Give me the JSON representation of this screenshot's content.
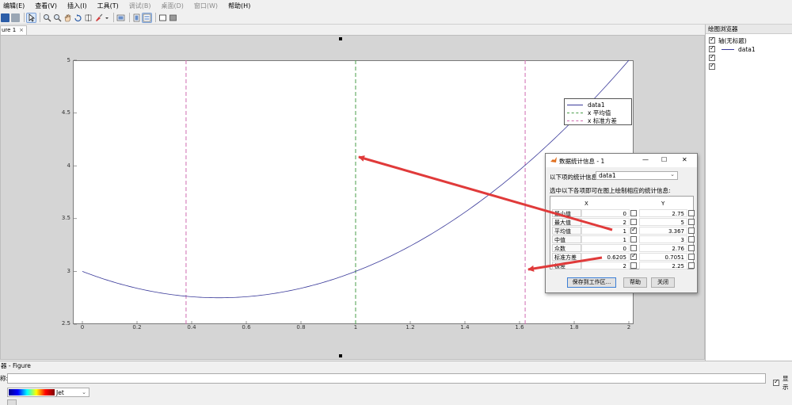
{
  "menu": [
    "编辑(E)",
    "查看(V)",
    "插入(I)",
    "工具(T)",
    "调试(B)",
    "桌面(D)",
    "窗口(W)",
    "帮助(H)"
  ],
  "menu_disabled": [
    false,
    false,
    false,
    false,
    true,
    true,
    true,
    false
  ],
  "tab": {
    "label": "ure 1",
    "close": "×"
  },
  "plot_browser": {
    "title": "绘图浏览器",
    "items": [
      {
        "label": "轴(无标题)",
        "checked": true
      },
      {
        "label": "data1",
        "checked": true
      },
      {
        "label": "",
        "checked": true
      },
      {
        "label": "",
        "checked": true
      }
    ]
  },
  "bottom": {
    "title": "器 - Figure",
    "name_label": "称:",
    "colormap_value": "Jet",
    "show_label": "显示"
  },
  "chart_data": {
    "type": "line",
    "xlim": [
      0,
      2
    ],
    "ylim": [
      2.5,
      5
    ],
    "xticks": [
      "0",
      "0.2",
      "0.4",
      "0.6",
      "0.8",
      "1",
      "1.2",
      "1.4",
      "1.6",
      "1.8",
      "2"
    ],
    "yticks": [
      "2.5",
      "3",
      "3.5",
      "4",
      "4.5",
      "5"
    ],
    "series": [
      {
        "name": "data1",
        "function": "y = x^2 - x + 3",
        "x_range": [
          0,
          2
        ],
        "color": "#3a3a9a"
      }
    ],
    "vlines": [
      {
        "name": "x 平均值",
        "x": 1.0,
        "color": "#4a9e4a"
      },
      {
        "name": "x 标准方差",
        "x": 0.3795,
        "color": "#d06ab0"
      },
      {
        "name": "x 标准方差",
        "x": 1.6205,
        "color": "#d06ab0"
      }
    ],
    "legend": [
      "data1",
      "x 平均值",
      "x 标准方差"
    ],
    "legend_position": "top-right"
  },
  "dialog": {
    "title": "数据统计信息 - 1",
    "source_label": "以下项的统计信息",
    "source_value": "data1",
    "instruction": "选中以下各项即可在图上绘制相应的统计信息:",
    "col_x": "X",
    "col_y": "Y",
    "rows": [
      {
        "name": "最小值",
        "x": "0",
        "x_checked": false,
        "y": "2.75",
        "y_checked": false
      },
      {
        "name": "最大值",
        "x": "2",
        "x_checked": false,
        "y": "5",
        "y_checked": false
      },
      {
        "name": "平均值",
        "x": "1",
        "x_checked": true,
        "y": "3.367",
        "y_checked": false
      },
      {
        "name": "中值",
        "x": "1",
        "x_checked": false,
        "y": "3",
        "y_checked": false
      },
      {
        "name": "众数",
        "x": "0",
        "x_checked": false,
        "y": "2.76",
        "y_checked": false
      },
      {
        "name": "标准方差",
        "x": "0.6205",
        "x_checked": true,
        "y": "0.7051",
        "y_checked": false
      },
      {
        "name": "极差",
        "x": "2",
        "x_checked": false,
        "y": "2.25",
        "y_checked": false
      }
    ],
    "save_button": "保存到工作区...",
    "help_button": "帮助",
    "close_button": "关闭"
  },
  "colors": {
    "arrow": "#e03a3a",
    "mean_line": "#4a9e4a",
    "std_line": "#d06ab0",
    "data_line": "#3a3a9a"
  }
}
